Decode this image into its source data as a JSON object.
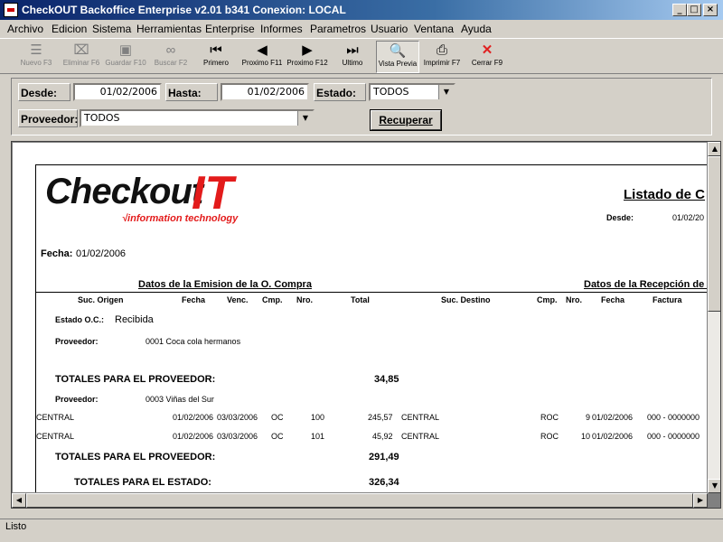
{
  "window": {
    "title": "CheckOUT Backoffice Enterprise v2.01 b341 Conexion: LOCAL",
    "min_label": "_",
    "max_label": "□",
    "close_label": "×"
  },
  "menu": [
    "Archivo",
    "Edicion",
    "Sistema",
    "Herramientas",
    "Enterprise",
    "Informes",
    "Parametros",
    "Usuario",
    "Ventana",
    "Ayuda"
  ],
  "toolbar": [
    {
      "label": "Nuevo F3",
      "icon": "new-icon",
      "glyph": "☰",
      "enabled": false
    },
    {
      "label": "Eliminar F6",
      "icon": "delete-icon",
      "glyph": "⌧",
      "enabled": false
    },
    {
      "label": "Guardar F10",
      "icon": "save-icon",
      "glyph": "▣",
      "enabled": false
    },
    {
      "label": "Buscar F2",
      "icon": "binoculars-icon",
      "glyph": "∞",
      "enabled": false
    },
    {
      "label": "Primero",
      "icon": "first-icon",
      "glyph": "⏮",
      "enabled": true
    },
    {
      "label": "Proximo F11",
      "icon": "previous-icon",
      "glyph": "◀",
      "enabled": true
    },
    {
      "label": "Proximo F12",
      "icon": "next-icon",
      "glyph": "▶",
      "enabled": true
    },
    {
      "label": "Ultimo",
      "icon": "last-icon",
      "glyph": "⏭",
      "enabled": true
    },
    {
      "label": "Vista Previa",
      "icon": "preview-icon",
      "glyph": "🔍",
      "enabled": true,
      "pressed": true
    },
    {
      "label": "Imprimir F7",
      "icon": "printer-icon",
      "glyph": "⎙",
      "enabled": true
    },
    {
      "label": "Cerrar F9",
      "icon": "close-x-icon",
      "glyph": "✕",
      "enabled": true,
      "color": "#e02020"
    }
  ],
  "filters": {
    "desde_label": "Desde:",
    "desde_value": "01/02/2006",
    "hasta_label": "Hasta:",
    "hasta_value": "01/02/2006",
    "estado_label": "Estado:",
    "estado_value": "TODOS",
    "proveedor_label": "Proveedor:",
    "proveedor_value": "TODOS",
    "recuperar_label": "Recuperar"
  },
  "report": {
    "logo_main": "Checkout",
    "logo_it": "IT",
    "logo_sub": "√information technology",
    "title": "Listado de C",
    "desde_label": "Desde:",
    "desde_value": "01/02/20",
    "fecha_label": "Fecha:",
    "fecha_value": "01/02/2006",
    "section_emision": "Datos de la Emision de la O. Compra",
    "section_recepcion": "Datos de la Recepción de la O",
    "columns": [
      "Suc. Origen",
      "Fecha",
      "Venc.",
      "Cmp.",
      "Nro.",
      "Total",
      "Suc. Destino",
      "Cmp.",
      "Nro.",
      "Fecha",
      "Factura"
    ],
    "estado_label": "Estado O.C.:",
    "estado_value": "Recibida",
    "proveedor_label": "Proveedor:",
    "prov1": "0001 Coca cola hermanos",
    "totales_prov_label": "TOTALES PARA EL PROVEEDOR:",
    "total_prov1": "34,85",
    "prov2": "0003 Viñas del Sur",
    "rows": [
      {
        "suc_origen": "CENTRAL",
        "fecha": "01/02/2006",
        "venc": "03/03/2006",
        "cmp": "OC",
        "nro": "100",
        "total": "245,57",
        "suc_destino": "CENTRAL",
        "cmp_r": "ROC",
        "nro_r": "9",
        "fecha_r": "01/02/2006",
        "factura": "000 - 0000000"
      },
      {
        "suc_origen": "CENTRAL",
        "fecha": "01/02/2006",
        "venc": "03/03/2006",
        "cmp": "OC",
        "nro": "101",
        "total": "45,92",
        "suc_destino": "CENTRAL",
        "cmp_r": "ROC",
        "nro_r": "10",
        "fecha_r": "01/02/2006",
        "factura": "000 - 0000000"
      }
    ],
    "total_prov2": "291,49",
    "totales_estado_label": "TOTALES PARA EL ESTADO:",
    "total_estado": "326,34"
  },
  "status": "Listo"
}
